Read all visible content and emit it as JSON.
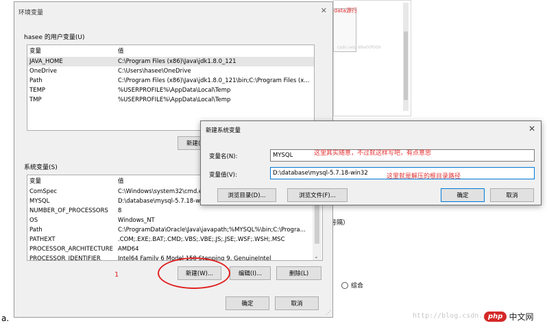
{
  "background": {
    "red_snippet": "data源行",
    "gray_snippet": "csdn.net/ 9lke00f009",
    "parens_text": "号隔）",
    "radio_label": "综合",
    "watermark": "http://blog.csdn.",
    "logo_oval": "php",
    "logo_text": "中文网",
    "figure_label": "a."
  },
  "main_window": {
    "title": "环境变量",
    "user_group_label": "hasee 的用户变量(U)",
    "user_columns": [
      "变量",
      "值"
    ],
    "user_rows": [
      {
        "name": "JAVA_HOME",
        "value": "C:\\Program Files (x86)\\Java\\jdk1.8.0_121"
      },
      {
        "name": "OneDrive",
        "value": "C:\\Users\\hasee\\OneDrive"
      },
      {
        "name": "Path",
        "value": "C:\\Program Files (x86)\\Java\\jdk1.8.0_121\\bin;C:\\Program Files (x..."
      },
      {
        "name": "TEMP",
        "value": "%USERPROFILE%\\AppData\\Local\\Temp"
      },
      {
        "name": "TMP",
        "value": "%USERPROFILE%\\AppData\\Local\\Temp"
      }
    ],
    "user_new_button": "新建(",
    "system_group_label": "系统变量(S)",
    "system_columns": [
      "变量",
      "值"
    ],
    "system_rows": [
      {
        "name": "ComSpec",
        "value": "C:\\Windows\\system32\\cmd.e"
      },
      {
        "name": "MYSQL",
        "value": "D:\\database\\mysql-5.7.18-w"
      },
      {
        "name": "NUMBER_OF_PROCESSORS",
        "value": "8"
      },
      {
        "name": "OS",
        "value": "Windows_NT"
      },
      {
        "name": "Path",
        "value": "C:\\ProgramData\\Oracle\\Java\\javapath;%MYSQL%\\bin;C:\\Progra..."
      },
      {
        "name": "PATHEXT",
        "value": ".COM;.EXE;.BAT;.CMD;.VBS;.VBE;.JS;.JSE;.WSF;.WSH;.MSC"
      },
      {
        "name": "PROCESSOR_ARCHITECTURE",
        "value": "AMD64"
      },
      {
        "name": "PROCESSOR_IDENTIFIER",
        "value": "Intel64 Family 6 Model 158 Stepping 9, GenuineIntel"
      }
    ],
    "sys_new_button": "新建(W)...",
    "sys_edit_button": "编辑(I)...",
    "sys_delete_button": "删除(L)",
    "ok_button": "确定",
    "cancel_button": "取消"
  },
  "dialog": {
    "title": "新建系统变量",
    "name_label": "变量名(N):",
    "name_value": "MYSQL",
    "value_label": "变量值(V):",
    "value_value": "D:\\database\\mysql-5.7.18-win32",
    "browse_dir_button": "浏览目录(D)...",
    "browse_file_button": "浏览文件(F)...",
    "ok_button": "确定",
    "cancel_button": "取消"
  },
  "annotations": {
    "note1": "这里其实随意，不过就这样写吧，有点意思",
    "note2": "这里就是解压的根目录路径",
    "step_number": "1"
  },
  "colors": {
    "annotation_red": "#e53030",
    "focus_blue": "#0078d7"
  }
}
